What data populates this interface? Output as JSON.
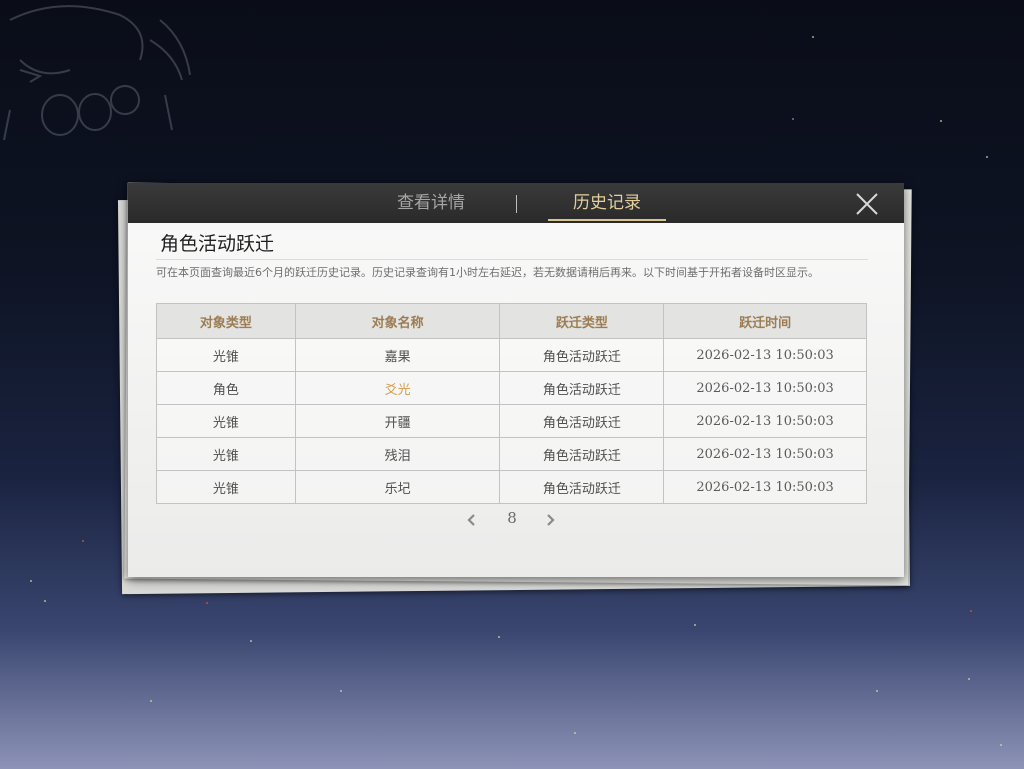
{
  "tabs": [
    {
      "label": "查看详情",
      "active": false
    },
    {
      "label": "历史记录",
      "active": true
    }
  ],
  "section_title": "角色活动跃迁",
  "notice": "可在本页面查询最近6个月的跃迁历史记录。历史记录查询有1小时左右延迟，若无数据请稍后再来。以下时间基于开拓者设备时区显示。",
  "table": {
    "headers": [
      "对象类型",
      "对象名称",
      "跃迁类型",
      "跃迁时间"
    ],
    "rows": [
      {
        "type": "光锥",
        "name": "嘉果",
        "warp": "角色活动跃迁",
        "time": "2026-02-13 10:50:03",
        "highlight": false
      },
      {
        "type": "角色",
        "name": "爻光",
        "warp": "角色活动跃迁",
        "time": "2026-02-13 10:50:03",
        "highlight": true
      },
      {
        "type": "光锥",
        "name": "开疆",
        "warp": "角色活动跃迁",
        "time": "2026-02-13 10:50:03",
        "highlight": false
      },
      {
        "type": "光锥",
        "name": "残泪",
        "warp": "角色活动跃迁",
        "time": "2026-02-13 10:50:03",
        "highlight": false
      },
      {
        "type": "光锥",
        "name": "乐圮",
        "warp": "角色活动跃迁",
        "time": "2026-02-13 10:50:03",
        "highlight": false
      }
    ]
  },
  "pagination": {
    "current_page": "8"
  },
  "icons": {
    "close": "close-icon",
    "prev": "chevron-left-icon",
    "next": "chevron-right-icon"
  },
  "colors": {
    "active_tab": "#e4cf9c",
    "header_text": "#9c7d53",
    "highlight_name": "#d59b4c"
  }
}
